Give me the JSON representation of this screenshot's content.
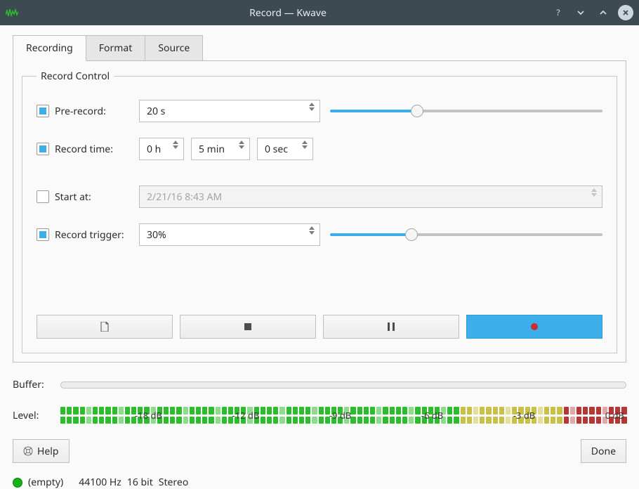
{
  "window": {
    "title": "Record — Kwave"
  },
  "tabs": {
    "recording": "Recording",
    "format": "Format",
    "source": "Source"
  },
  "group": {
    "title": "Record Control"
  },
  "prerecord": {
    "label": "Pre-record:",
    "value": "20 s",
    "slider_pct": 32
  },
  "record_time": {
    "label": "Record time:",
    "hours": "0 h",
    "minutes": "5 min",
    "seconds": "0 sec"
  },
  "start_at": {
    "label": "Start at:",
    "value": "2/21/16 8:43 AM",
    "checked": false
  },
  "trigger": {
    "label": "Record trigger:",
    "value": "30%",
    "slider_pct": 30
  },
  "buffer": {
    "label": "Buffer:"
  },
  "level": {
    "label": "Level:",
    "ticks": [
      "-18 dB",
      "-12 dB",
      "-9 dB",
      "-6 dB",
      "-3 dB",
      "0 dB"
    ]
  },
  "buttons": {
    "help": "Help",
    "done": "Done"
  },
  "status": {
    "state": "(empty)",
    "rate": "44100 Hz",
    "depth": "16 bit",
    "channels": "Stereo"
  }
}
